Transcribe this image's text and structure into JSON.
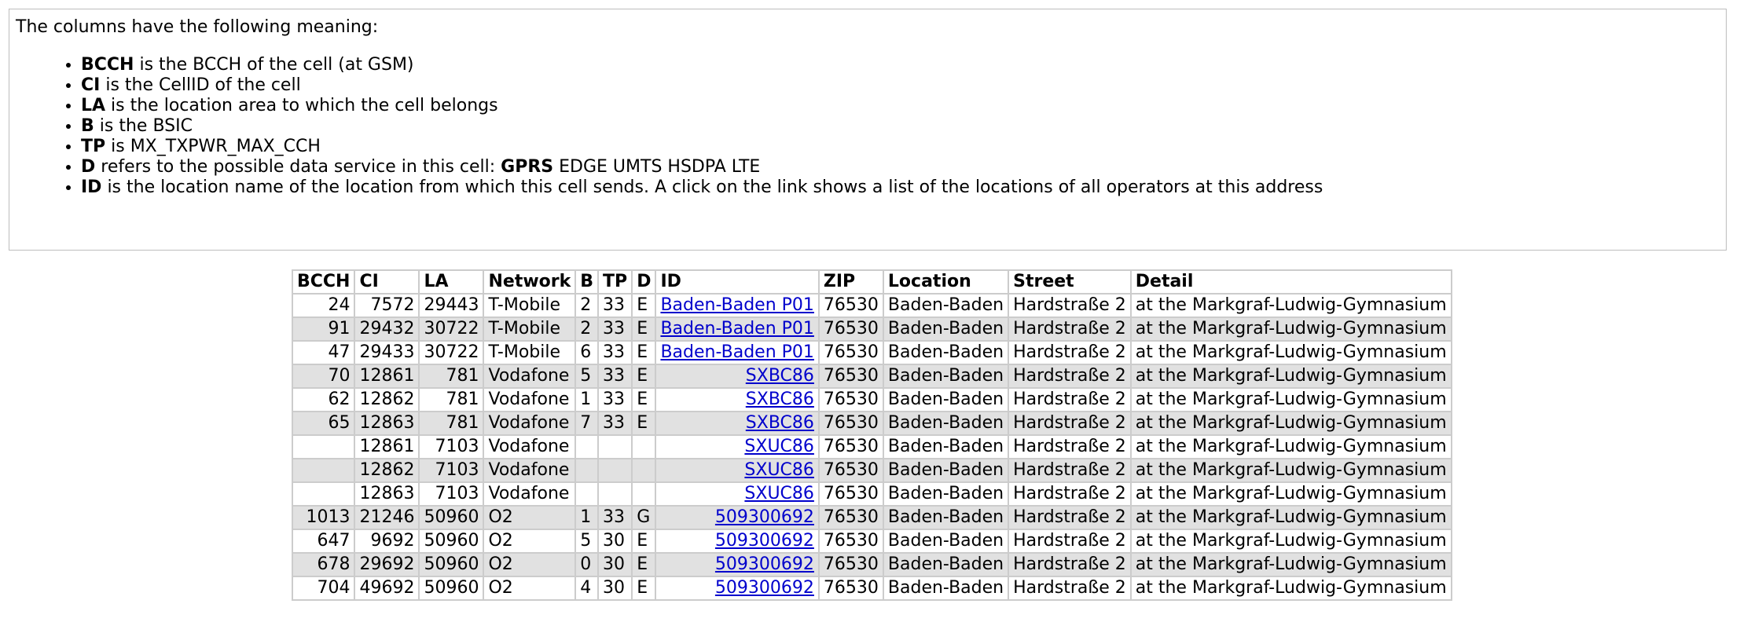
{
  "legend": {
    "intro": "The columns have the following meaning:",
    "items": [
      {
        "key": "BCCH",
        "text": " is the BCCH of the cell (at GSM)"
      },
      {
        "key": "CI",
        "text": " is the CellID of the cell"
      },
      {
        "key": "LA",
        "text": " is the location area to which the cell belongs"
      },
      {
        "key": "B",
        "text": " is the BSIC"
      },
      {
        "key": "TP",
        "text": " is MX_TXPWR_MAX_CCH"
      },
      {
        "key": "D",
        "text": " refers to the possible data service in this cell: ",
        "bold_suffix": "GPRS",
        "suffix": " EDGE UMTS HSDPA LTE"
      },
      {
        "key": "ID",
        "text": " is the location name of the location from which this cell sends. A click on the link shows a list of the locations of all operators at this address"
      }
    ]
  },
  "table": {
    "headers": [
      "BCCH",
      "CI",
      "LA",
      "Network",
      "B",
      "TP",
      "D",
      "ID",
      "ZIP",
      "Location",
      "Street",
      "Detail"
    ],
    "rows": [
      {
        "bcch": "24",
        "ci": "7572",
        "la": "29443",
        "network": "T-Mobile",
        "b": "2",
        "tp": "33",
        "d": "E",
        "id": "Baden-Baden P01",
        "zip": "76530",
        "location": "Baden-Baden",
        "street": "Hardstraße 2",
        "detail": "at the Markgraf-Ludwig-Gymnasium"
      },
      {
        "bcch": "91",
        "ci": "29432",
        "la": "30722",
        "network": "T-Mobile",
        "b": "2",
        "tp": "33",
        "d": "E",
        "id": "Baden-Baden P01",
        "zip": "76530",
        "location": "Baden-Baden",
        "street": "Hardstraße 2",
        "detail": "at the Markgraf-Ludwig-Gymnasium"
      },
      {
        "bcch": "47",
        "ci": "29433",
        "la": "30722",
        "network": "T-Mobile",
        "b": "6",
        "tp": "33",
        "d": "E",
        "id": "Baden-Baden P01",
        "zip": "76530",
        "location": "Baden-Baden",
        "street": "Hardstraße 2",
        "detail": "at the Markgraf-Ludwig-Gymnasium"
      },
      {
        "bcch": "70",
        "ci": "12861",
        "la": "781",
        "network": "Vodafone",
        "b": "5",
        "tp": "33",
        "d": "E",
        "id": "SXBC86",
        "zip": "76530",
        "location": "Baden-Baden",
        "street": "Hardstraße 2",
        "detail": "at the Markgraf-Ludwig-Gymnasium"
      },
      {
        "bcch": "62",
        "ci": "12862",
        "la": "781",
        "network": "Vodafone",
        "b": "1",
        "tp": "33",
        "d": "E",
        "id": "SXBC86",
        "zip": "76530",
        "location": "Baden-Baden",
        "street": "Hardstraße 2",
        "detail": "at the Markgraf-Ludwig-Gymnasium"
      },
      {
        "bcch": "65",
        "ci": "12863",
        "la": "781",
        "network": "Vodafone",
        "b": "7",
        "tp": "33",
        "d": "E",
        "id": "SXBC86",
        "zip": "76530",
        "location": "Baden-Baden",
        "street": "Hardstraße 2",
        "detail": "at the Markgraf-Ludwig-Gymnasium"
      },
      {
        "bcch": "",
        "ci": "12861",
        "la": "7103",
        "network": "Vodafone",
        "b": "",
        "tp": "",
        "d": "",
        "id": "SXUC86",
        "zip": "76530",
        "location": "Baden-Baden",
        "street": "Hardstraße 2",
        "detail": "at the Markgraf-Ludwig-Gymnasium"
      },
      {
        "bcch": "",
        "ci": "12862",
        "la": "7103",
        "network": "Vodafone",
        "b": "",
        "tp": "",
        "d": "",
        "id": "SXUC86",
        "zip": "76530",
        "location": "Baden-Baden",
        "street": "Hardstraße 2",
        "detail": "at the Markgraf-Ludwig-Gymnasium"
      },
      {
        "bcch": "",
        "ci": "12863",
        "la": "7103",
        "network": "Vodafone",
        "b": "",
        "tp": "",
        "d": "",
        "id": "SXUC86",
        "zip": "76530",
        "location": "Baden-Baden",
        "street": "Hardstraße 2",
        "detail": "at the Markgraf-Ludwig-Gymnasium"
      },
      {
        "bcch": "1013",
        "ci": "21246",
        "la": "50960",
        "network": "O2",
        "b": "1",
        "tp": "33",
        "d": "G",
        "id": "509300692",
        "zip": "76530",
        "location": "Baden-Baden",
        "street": "Hardstraße 2",
        "detail": "at the Markgraf-Ludwig-Gymnasium"
      },
      {
        "bcch": "647",
        "ci": "9692",
        "la": "50960",
        "network": "O2",
        "b": "5",
        "tp": "30",
        "d": "E",
        "id": "509300692",
        "zip": "76530",
        "location": "Baden-Baden",
        "street": "Hardstraße 2",
        "detail": "at the Markgraf-Ludwig-Gymnasium"
      },
      {
        "bcch": "678",
        "ci": "29692",
        "la": "50960",
        "network": "O2",
        "b": "0",
        "tp": "30",
        "d": "E",
        "id": "509300692",
        "zip": "76530",
        "location": "Baden-Baden",
        "street": "Hardstraße 2",
        "detail": "at the Markgraf-Ludwig-Gymnasium"
      },
      {
        "bcch": "704",
        "ci": "49692",
        "la": "50960",
        "network": "O2",
        "b": "4",
        "tp": "30",
        "d": "E",
        "id": "509300692",
        "zip": "76530",
        "location": "Baden-Baden",
        "street": "Hardstraße 2",
        "detail": "at the Markgraf-Ludwig-Gymnasium"
      }
    ]
  },
  "colors": {
    "link": "#0000cc",
    "row_alt": "#e1e1e1",
    "border": "#cccccc"
  }
}
